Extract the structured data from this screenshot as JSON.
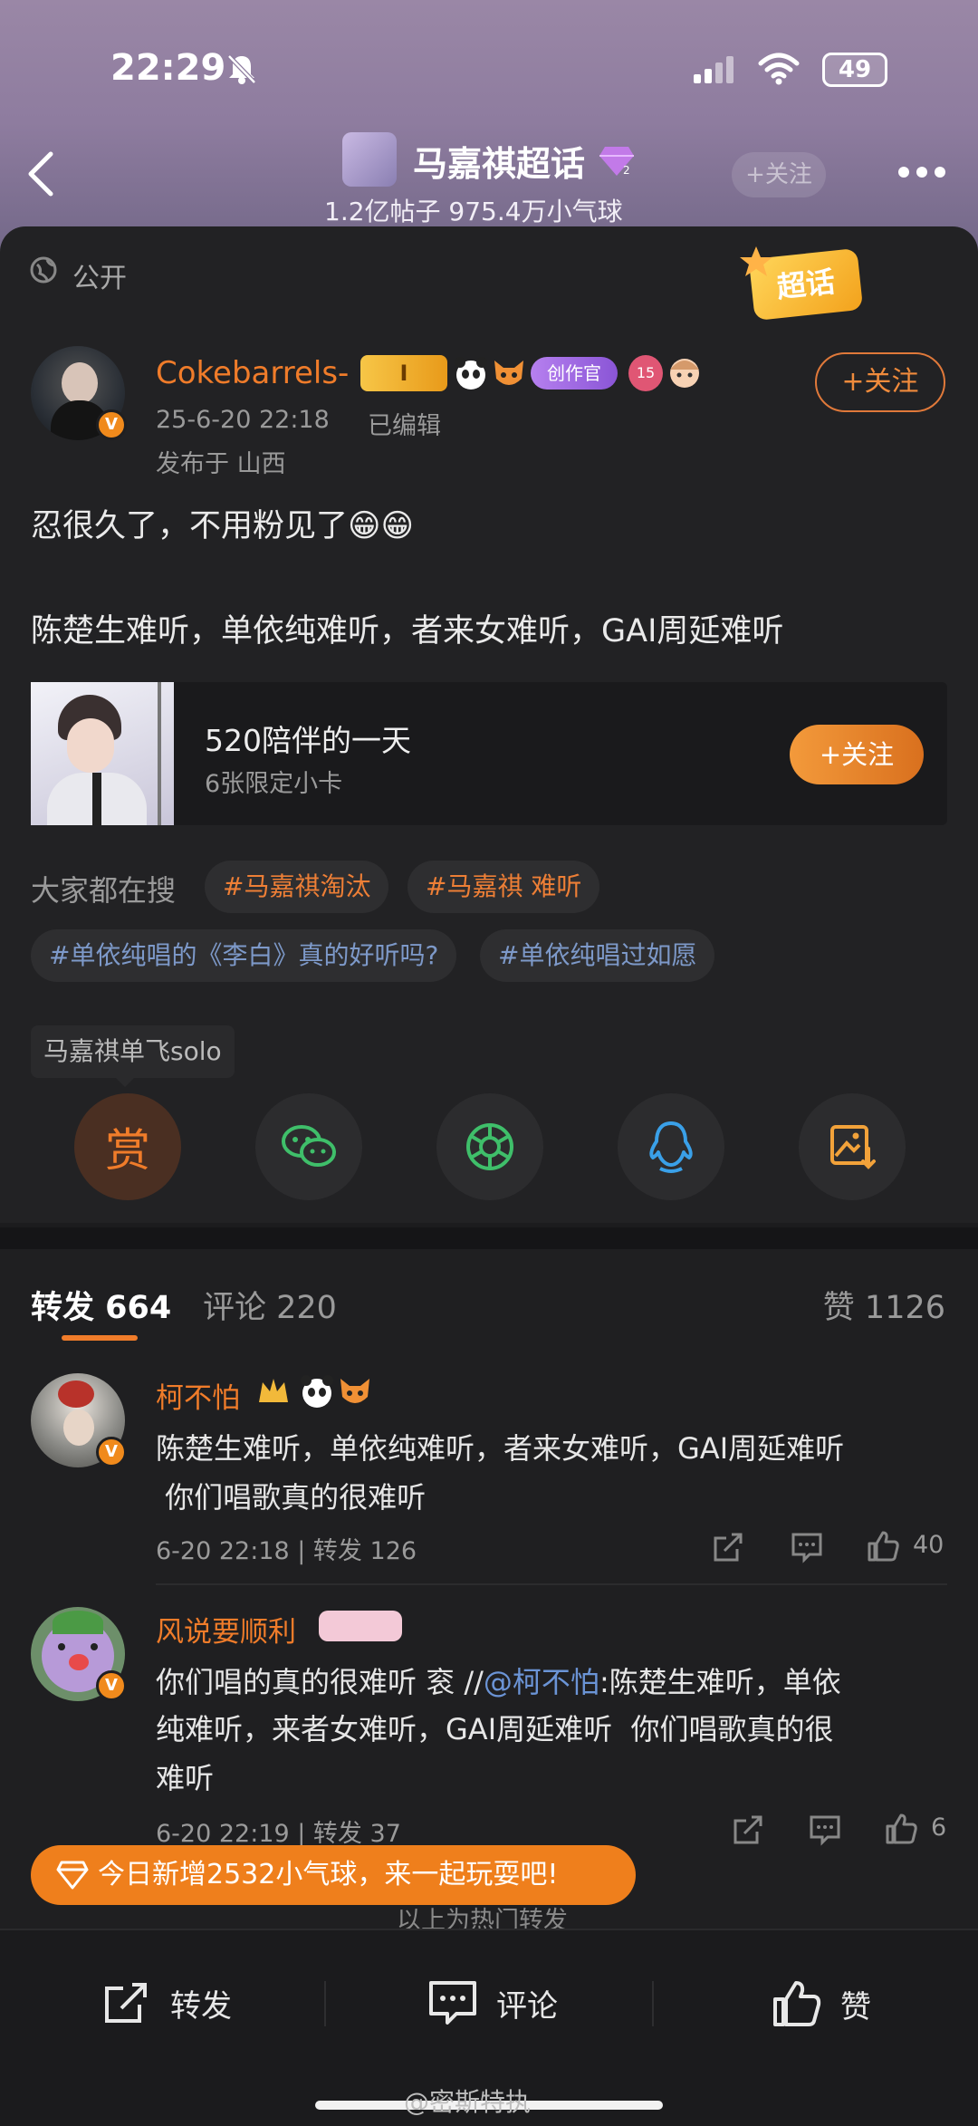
{
  "status_bar": {
    "time": "22:29",
    "battery": "49"
  },
  "header": {
    "title": "马嘉祺超话",
    "stats": "1.2亿帖子 975.4万小气球",
    "follow_label": "+关注"
  },
  "visibility": "公开",
  "supertopic_badge": "超话",
  "post": {
    "username": "Cokebarrels-",
    "level_badge": "I",
    "creator_badge": "创作官",
    "rank_badge": "15",
    "timestamp": "25-6-20 22:18",
    "edited": "已编辑",
    "location": "发布于 山西",
    "follow_label": "+关注",
    "line1": "忍很久了，不用粉见了😁😁",
    "line2": "陈楚生难听，单依纯难听，者来女难听，GAI周延难听"
  },
  "promo": {
    "title": "520陪伴的一天",
    "subtitle": "6张限定小卡",
    "button": "+关注"
  },
  "search": {
    "label": "大家都在搜",
    "tags": [
      "#马嘉祺淘汰",
      "#马嘉祺 难听",
      "#单依纯唱的《李白》真的好听吗?",
      "#单依纯唱过如愿"
    ]
  },
  "topic_label": "马嘉祺单飞solo",
  "share": {
    "reward_label": "赏"
  },
  "tabs": {
    "repost": "转发 664",
    "comment": "评论 220",
    "like": "赞 1126"
  },
  "comments": [
    {
      "username": "柯不怕",
      "text1": "陈楚生难听，单依纯难听，者来女难听，GAI周延难听",
      "text2": " 你们唱歌真的很难听",
      "meta": "6-20 22:18 | 转发 126",
      "likes": "40"
    },
    {
      "username": "风说要顺利",
      "text_prefix": "你们唱的真的很难听 衮 //",
      "mention": "@柯不怕",
      "text_suffix": ":陈楚生难听，单依",
      "text2": "纯难听，来者女难听，GAI周延难听  你们唱歌真的很",
      "text3": "难听",
      "meta": "6-20 22:19 | 转发 37",
      "likes": "6"
    }
  ],
  "toast": "今日新增2532小气球，来一起玩耍吧!",
  "footer_note": "以上为热门转发",
  "bottom_bar": {
    "repost": "转发",
    "comment": "评论",
    "like": "赞"
  },
  "watermark": "@密斯特执"
}
